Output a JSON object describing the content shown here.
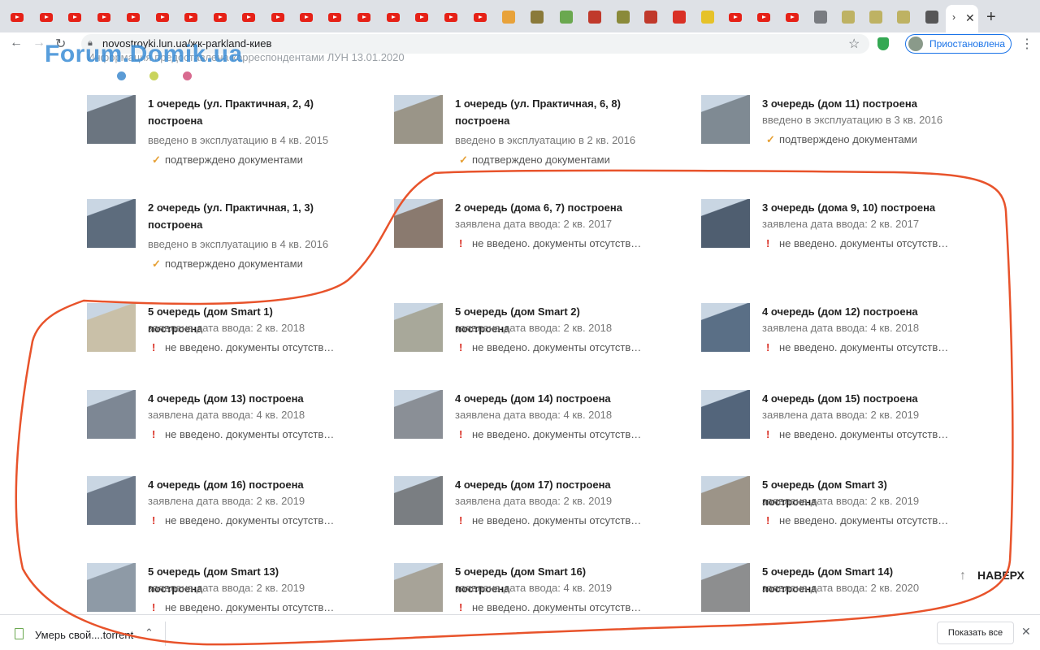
{
  "browser": {
    "url": "novostroyki.lun.ua/жк-parkland-киев",
    "profile_status": "Приостановлена",
    "tab_icons": [
      "youtube-icon",
      "youtube-icon",
      "youtube-icon",
      "youtube-icon",
      "youtube-icon",
      "youtube-icon",
      "youtube-icon",
      "youtube-icon",
      "youtube-icon",
      "youtube-icon",
      "youtube-icon",
      "youtube-icon",
      "youtube-icon",
      "youtube-icon",
      "youtube-icon",
      "youtube-icon",
      "youtube-icon"
    ]
  },
  "watermark": "Forum.Domik.ua",
  "info_line": "Информация предоставлена корреспондентами ЛУН 13.01.2020",
  "dots": [
    "#5b9bd5",
    "#c9d45c",
    "#d86a8f"
  ],
  "cards": [
    {
      "title": "1 очередь (ул. Практичная, 2, 4) построена",
      "date": "введено в эксплуатацию в 4 кв. 2015",
      "status": "подтверждено документами",
      "confirmed": true
    },
    {
      "title": "1 очередь (ул. Практичная, 6, 8) построена",
      "date": "введено в эксплуатацию в 2 кв. 2016",
      "status": "подтверждено документами",
      "confirmed": true
    },
    {
      "title": "3 очередь (дом 11) построена",
      "date": "введено в эксплуатацию в 3 кв. 2016",
      "status": "подтверждено документами",
      "confirmed": true
    },
    {
      "title": "2 очередь (ул. Практичная, 1, 3) построена",
      "date": "введено в эксплуатацию в 4 кв. 2016",
      "status": "подтверждено документами",
      "confirmed": true
    },
    {
      "title": "2 очередь (дома 6, 7) построена",
      "date": "заявлена дата ввода: 2 кв. 2017",
      "status": "не введено. документы отсутств…",
      "confirmed": false
    },
    {
      "title": "3 очередь (дома 9, 10) построена",
      "date": "заявлена дата ввода: 2 кв. 2017",
      "status": "не введено. документы отсутств…",
      "confirmed": false
    },
    {
      "title": "5 очередь (дом Smart 1) построена",
      "date": "заявлена дата ввода: 2 кв. 2018",
      "status": "не введено. документы отсутств…",
      "confirmed": false
    },
    {
      "title": "5 очередь (дом Smart 2) построена",
      "date": "заявлена дата ввода: 2 кв. 2018",
      "status": "не введено. документы отсутств…",
      "confirmed": false
    },
    {
      "title": "4 очередь (дом 12) построена",
      "date": "заявлена дата ввода: 4 кв. 2018",
      "status": "не введено. документы отсутств…",
      "confirmed": false
    },
    {
      "title": "4 очередь (дом 13) построена",
      "date": "заявлена дата ввода: 4 кв. 2018",
      "status": "не введено. документы отсутств…",
      "confirmed": false
    },
    {
      "title": "4 очередь (дом 14) построена",
      "date": "заявлена дата ввода: 4 кв. 2018",
      "status": "не введено. документы отсутств…",
      "confirmed": false
    },
    {
      "title": "4 очередь (дом 15) построена",
      "date": "заявлена дата ввода: 2 кв. 2019",
      "status": "не введено. документы отсутств…",
      "confirmed": false
    },
    {
      "title": "4 очередь (дом 16) построена",
      "date": "заявлена дата ввода: 2 кв. 2019",
      "status": "не введено. документы отсутств…",
      "confirmed": false
    },
    {
      "title": "4 очередь (дом 17) построена",
      "date": "заявлена дата ввода: 2 кв. 2019",
      "status": "не введено. документы отсутств…",
      "confirmed": false
    },
    {
      "title": "5 очередь (дом Smart 3) построена",
      "date": "заявлена дата ввода: 2 кв. 2019",
      "status": "не введено. документы отсутств…",
      "confirmed": false
    },
    {
      "title": "5 очередь (дом Smart 13) построена",
      "date": "заявлена дата ввода: 2 кв. 2019",
      "status": "не введено. документы отсутств…",
      "confirmed": false
    },
    {
      "title": "5 очередь (дом Smart 16) построена",
      "date": "заявлена дата ввода: 4 кв. 2019",
      "status": "не введено. документы отсутств…",
      "confirmed": false
    },
    {
      "title": "5 очередь (дом Smart 14) построена",
      "date": "заявлена дата ввода: 2 кв. 2020",
      "status": "",
      "confirmed": false
    }
  ],
  "to_top": "НАВЕРХ",
  "download": {
    "filename": "Умерь свой....torrent",
    "show_all": "Показать все"
  },
  "colors": {
    "annotation": "#e8532b",
    "confirmed_check": "#e6a035",
    "alert": "#d93025"
  }
}
